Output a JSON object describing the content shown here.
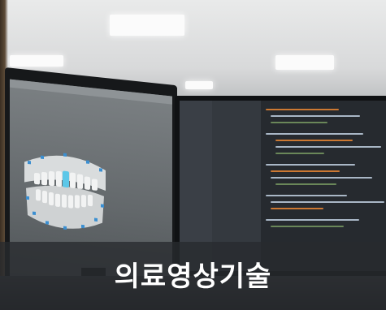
{
  "caption": {
    "text": "의료영상기술"
  },
  "colors": {
    "caption_background": "#2a2c30",
    "caption_text": "#ffffff",
    "ceiling": "#e9eaea",
    "code_keyword": "#cc7832",
    "code_string": "#6a8759",
    "code_default": "#a9b7c6"
  }
}
